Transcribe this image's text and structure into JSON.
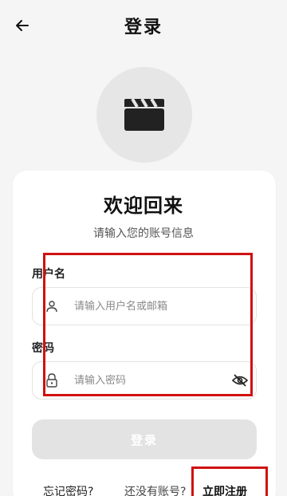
{
  "header": {
    "title": "登录",
    "back_icon": "arrow-left-icon"
  },
  "logo": {
    "icon": "clapperboard-icon"
  },
  "welcome": {
    "title": "欢迎回来",
    "subtitle": "请输入您的账号信息"
  },
  "form": {
    "username": {
      "label": "用户名",
      "placeholder": "请输入用户名或邮箱",
      "icon": "user-icon",
      "value": ""
    },
    "password": {
      "label": "密码",
      "placeholder": "请输入密码",
      "icon": "lock-icon",
      "toggle_icon": "eye-off-icon",
      "value": ""
    },
    "login_label": "登录"
  },
  "footer": {
    "forgot": "忘记密码?",
    "no_account": "还没有账号?",
    "register": "立即注册"
  },
  "colors": {
    "highlight": "#d01010",
    "background": "#f5f5f5",
    "button_disabled": "#e3e3e3"
  }
}
